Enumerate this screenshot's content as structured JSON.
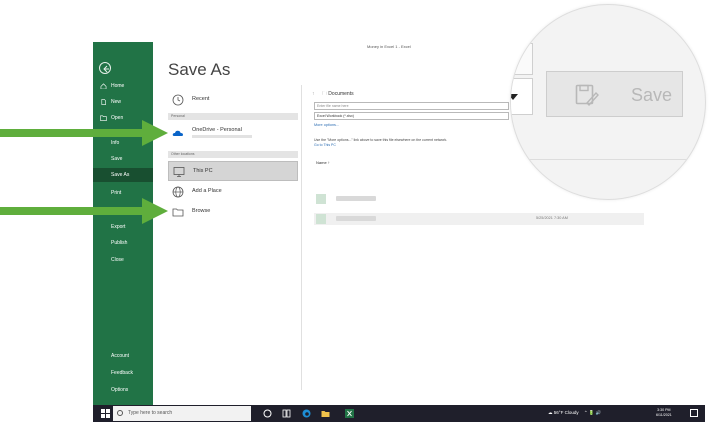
{
  "window": {
    "title": "Money in Excel 1  -  Excel"
  },
  "sidebar": {
    "items": [
      {
        "label": "Home",
        "icon": "home-icon"
      },
      {
        "label": "New",
        "icon": "new-file-icon"
      },
      {
        "label": "Open",
        "icon": "folder-open-icon"
      },
      {
        "label": "Info"
      },
      {
        "label": "Save"
      },
      {
        "label": "Save As",
        "active": true
      },
      {
        "label": "Print"
      },
      {
        "label": "Export"
      },
      {
        "label": "Publish"
      },
      {
        "label": "Close"
      },
      {
        "label": "Account"
      },
      {
        "label": "Feedback"
      },
      {
        "label": "Options"
      }
    ]
  },
  "page": {
    "title": "Save As"
  },
  "locations": {
    "recent": "Recent",
    "personal_section": "Personal",
    "onedrive": "OneDrive - Personal",
    "other_section": "Other locations",
    "this_pc": "This PC",
    "add_place": "Add a Place",
    "browse": "Browse"
  },
  "save_panel": {
    "breadcrumb": "Documents",
    "filename_placeholder": "Enter file name here",
    "filetype": "Excel Workbook (*.xlsx)",
    "more_options": "More options...",
    "note": "Use the \"More options...\" link above to save this file elsewhere on the current network.",
    "note_link": "Go to This PC",
    "name_column": "Name",
    "sort_arrow": "↑",
    "file_date": "5/25/2021 7:30 AM"
  },
  "magnifier": {
    "save_label": "Save"
  },
  "taskbar": {
    "search_placeholder": "Type here to search",
    "weather": "56°F  Cloudy",
    "clock_time": "3:30 PM",
    "clock_date": "6/11/2021"
  },
  "colors": {
    "excel_green": "#217346",
    "active_green": "#184f30",
    "arrow_green": "#5fae3c",
    "onedrive_blue": "#0a64c8"
  }
}
